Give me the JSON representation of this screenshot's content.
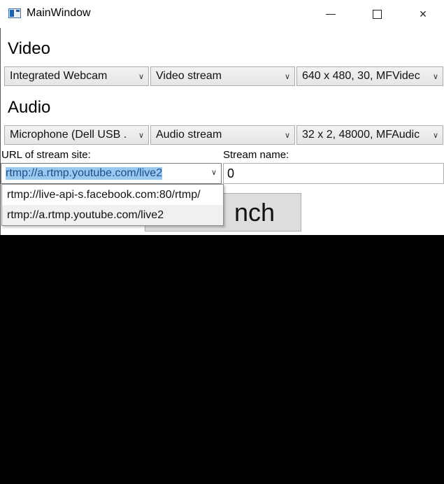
{
  "window": {
    "title": "MainWindow",
    "minimize": "minimize",
    "maximize": "maximize",
    "close": "×"
  },
  "video": {
    "section_label": "Video",
    "device": "Integrated Webcam",
    "stream": "Video stream",
    "format": "640 x 480, 30, MFVidec"
  },
  "audio": {
    "section_label": "Audio",
    "device": "Microphone (Dell USB .",
    "stream": "Audio stream",
    "format": "32 x 2, 48000, MFAudic"
  },
  "stream": {
    "url_label": "URL of stream site:",
    "name_label": "Stream name:",
    "url_value": "rtmp://a.rtmp.youtube.com/live2",
    "name_value": "0",
    "url_options": [
      "rtmp://live-api-s.facebook.com:80/rtmp/",
      "rtmp://a.rtmp.youtube.com/live2"
    ]
  },
  "launch_label_visible": "nch",
  "icons": {
    "dropdown_arrow": "chevron-down-icon",
    "app": "window-app-icon"
  },
  "colors": {
    "selection_highlight": "#99c9ef",
    "video_background": "#000000"
  }
}
